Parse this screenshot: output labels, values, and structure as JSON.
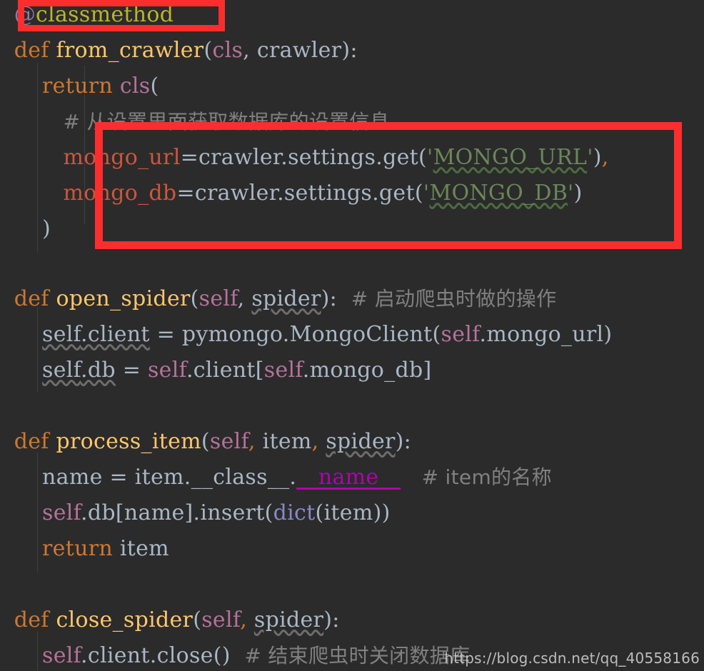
{
  "editor": {
    "background_color": "#2b2b2b",
    "default_text_color": "#a9b7c6",
    "language": "python",
    "filename_context": "scrapy MongoDB pipeline"
  },
  "colors": {
    "keyword": "#cc7832",
    "decorator": "#bbb529",
    "function_name": "#ffc66d",
    "self_keyword": "#b5729b",
    "keyword_argument": "#cc563c",
    "string": "#6a8759",
    "comment": "#808080",
    "builtin": "#8888c6",
    "dunder": "#b200b2",
    "annotation_box": "#fc2d2d",
    "indent_guide": "#3d3f41"
  },
  "code": {
    "line_01": {
      "decorator_at": "@",
      "decorator_name": "classmethod"
    },
    "line_02": {
      "kw_def": "def",
      "name": "from_crawler",
      "open_paren": "(",
      "arg_cls": "cls",
      "comma": ", ",
      "arg_crawler": "crawler",
      "close": "):"
    },
    "line_03": {
      "kw_return": "return",
      "cls": "cls",
      "paren": "("
    },
    "line_04": {
      "comment": "# 从设置里面获取数据库的设置信息"
    },
    "line_05": {
      "kwarg": "mongo_url",
      "eq": "=",
      "chain": "crawler.settings.get",
      "open": "(",
      "quote_open": "'",
      "string": "MONGO_URL",
      "quote_close": "'",
      "close": ")",
      "comma": ","
    },
    "line_06": {
      "kwarg": "mongo_db",
      "eq": "=",
      "chain": "crawler.settings.get",
      "open": "(",
      "quote_open": "'",
      "string": "MONGO_DB",
      "quote_close": "'",
      "close": ")"
    },
    "line_07": {
      "close_paren": ")"
    },
    "line_08": {
      "kw_def": "def",
      "name": "open_spider",
      "open_paren": "(",
      "arg_self": "self",
      "comma": ", ",
      "arg_spider": "spider",
      "close": "):",
      "comment": "# 启动爬虫时做的操作"
    },
    "line_09": {
      "self": "self",
      "dot_attr": ".client",
      "eq": " = ",
      "expr": "pymongo.MongoClient",
      "open": "(",
      "self2": "self",
      "attr2": ".mongo_url",
      "close": ")"
    },
    "line_10": {
      "self": "self",
      "dot_attr": ".db",
      "eq": " = ",
      "self2": "self",
      "attr2": ".client",
      "bracket_open": "[",
      "self3": "self",
      "attr3": ".mongo_db",
      "bracket_close": "]"
    },
    "line_11": {
      "kw_def": "def",
      "name": "process_item",
      "open_paren": "(",
      "arg_self": "self",
      "comma1": ", ",
      "arg_item": "item",
      "comma2": ", ",
      "arg_spider": "spider",
      "close": "):"
    },
    "line_12": {
      "var": "name",
      "eq": " = ",
      "obj": "item.",
      "class_dunder": "__class__",
      "dot": ".",
      "name_dunder": "__name__",
      "comment": "# item的名称"
    },
    "line_13": {
      "self": "self",
      "attr": ".db",
      "bracket_open": "[",
      "key": "name",
      "bracket_close": "]",
      "method": ".insert",
      "open": "(",
      "builtin": "dict",
      "open2": "(",
      "arg": "item",
      "close": "))"
    },
    "line_14": {
      "kw_return": "return",
      "value": "item"
    },
    "line_15": {
      "kw_def": "def",
      "name": "close_spider",
      "open_paren": "(",
      "arg_self": "self",
      "comma": ", ",
      "arg_spider": "spider",
      "close": "):"
    },
    "line_16": {
      "self": "self",
      "chain": ".client.close",
      "parens": "()",
      "comment": "# 结束爬虫时关闭数据库"
    }
  },
  "annotations": {
    "box_1_label": "highlight-classmethod-decorator",
    "box_2_label": "highlight-settings-retrieval-block"
  },
  "watermark": {
    "text": "https://blog.csdn.net/qq_40558166"
  }
}
